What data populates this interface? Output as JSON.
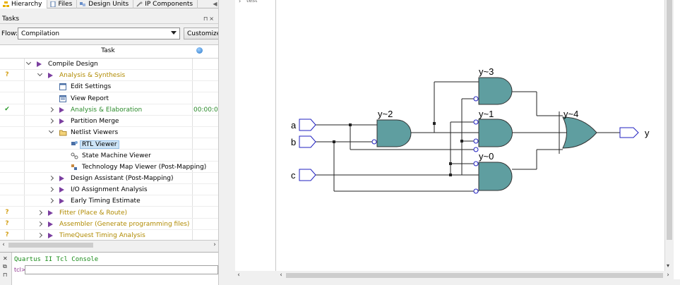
{
  "tabs": [
    {
      "label": "Hierarchy",
      "icon": "hierarchy-icon"
    },
    {
      "label": "Files",
      "icon": "files-icon"
    },
    {
      "label": "Design Units",
      "icon": "design-units-icon"
    },
    {
      "label": "IP Components",
      "icon": "ip-components-icon"
    }
  ],
  "tasks": {
    "header": "Tasks",
    "flow_label": "Flow:",
    "flow_value": "Compilation",
    "customize_label": "Customize...",
    "column_task": "Task",
    "rows": [
      {
        "status": "",
        "label": "Compile Design",
        "color": "normal",
        "time": ""
      },
      {
        "status": "?",
        "label": "Analysis & Synthesis",
        "color": "gold",
        "time": ""
      },
      {
        "status": "",
        "label": "Edit Settings",
        "color": "normal",
        "time": ""
      },
      {
        "status": "",
        "label": "View Report",
        "color": "normal",
        "time": ""
      },
      {
        "status": "✔",
        "label": "Analysis & Elaboration",
        "color": "green",
        "time": "00:00:0"
      },
      {
        "status": "",
        "label": "Partition Merge",
        "color": "normal",
        "time": ""
      },
      {
        "status": "",
        "label": "Netlist Viewers",
        "color": "normal",
        "time": ""
      },
      {
        "status": "",
        "label": "RTL Viewer",
        "color": "normal",
        "time": ""
      },
      {
        "status": "",
        "label": "State Machine Viewer",
        "color": "normal",
        "time": ""
      },
      {
        "status": "",
        "label": "Technology Map Viewer (Post-Mapping)",
        "color": "normal",
        "time": ""
      },
      {
        "status": "",
        "label": "Design Assistant (Post-Mapping)",
        "color": "normal",
        "time": ""
      },
      {
        "status": "",
        "label": "I/O Assignment Analysis",
        "color": "normal",
        "time": ""
      },
      {
        "status": "",
        "label": "Early Timing Estimate",
        "color": "normal",
        "time": ""
      },
      {
        "status": "?",
        "label": "Fitter (Place & Route)",
        "color": "gold",
        "time": ""
      },
      {
        "status": "?",
        "label": "Assembler (Generate programming files)",
        "color": "gold",
        "time": ""
      },
      {
        "status": "?",
        "label": "TimeQuest Timing Analysis",
        "color": "gold",
        "time": ""
      }
    ]
  },
  "console": {
    "title": "Quartus II Tcl Console",
    "prompt": "tcl>",
    "input_value": ""
  },
  "viewer": {
    "tree_item": "test",
    "inputs": [
      "a",
      "b",
      "c"
    ],
    "output": "y",
    "gates": [
      {
        "name": "y~2",
        "type": "AND"
      },
      {
        "name": "y~3",
        "type": "AND"
      },
      {
        "name": "y~1",
        "type": "AND"
      },
      {
        "name": "y~0",
        "type": "AND"
      },
      {
        "name": "y~4",
        "type": "OR"
      }
    ]
  },
  "colors": {
    "gate_fill": "#5f9ea0",
    "pin_stroke": "#2020c0",
    "selection": "#cde4f7",
    "status_ok": "#2a9a2a",
    "status_warn": "#d4a017"
  }
}
